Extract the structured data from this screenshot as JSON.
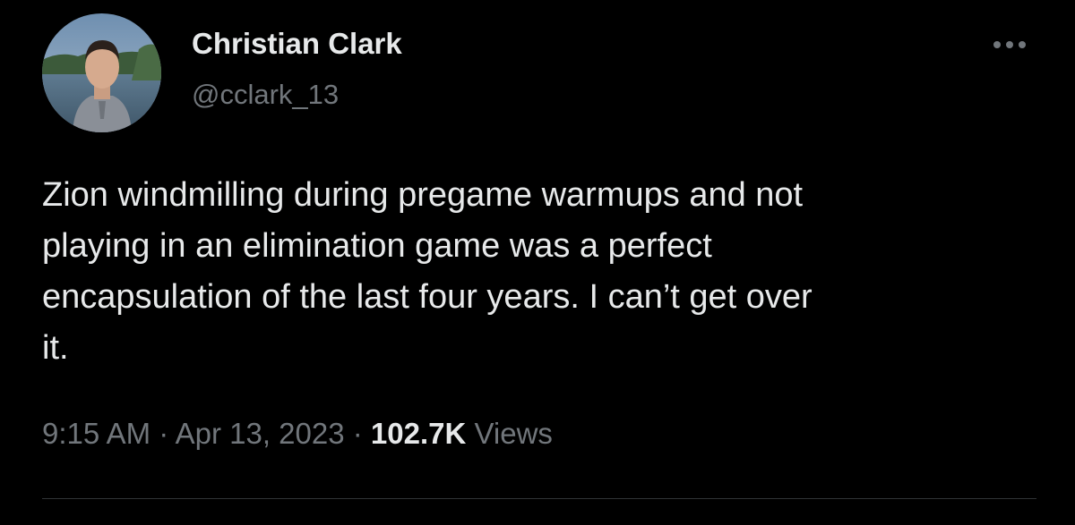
{
  "user": {
    "display_name": "Christian Clark",
    "handle": "@cclark_13",
    "avatar_icon": "profile-photo"
  },
  "actions": {
    "more_icon": "more-horizontal-icon"
  },
  "tweet": {
    "text": "Zion windmilling during pregame warmups and not\nplaying in an elimination game was a perfect\nencapsulation of the last four years. I can’t get over\nit.",
    "time": "9:15 AM",
    "separator": " · ",
    "date": "Apr 13, 2023",
    "views_count": "102.7K",
    "views_label": "Views"
  },
  "colors": {
    "background": "#000000",
    "primary_text": "#e7e9ea",
    "secondary_text": "#71767b",
    "divider": "#2f3336"
  }
}
